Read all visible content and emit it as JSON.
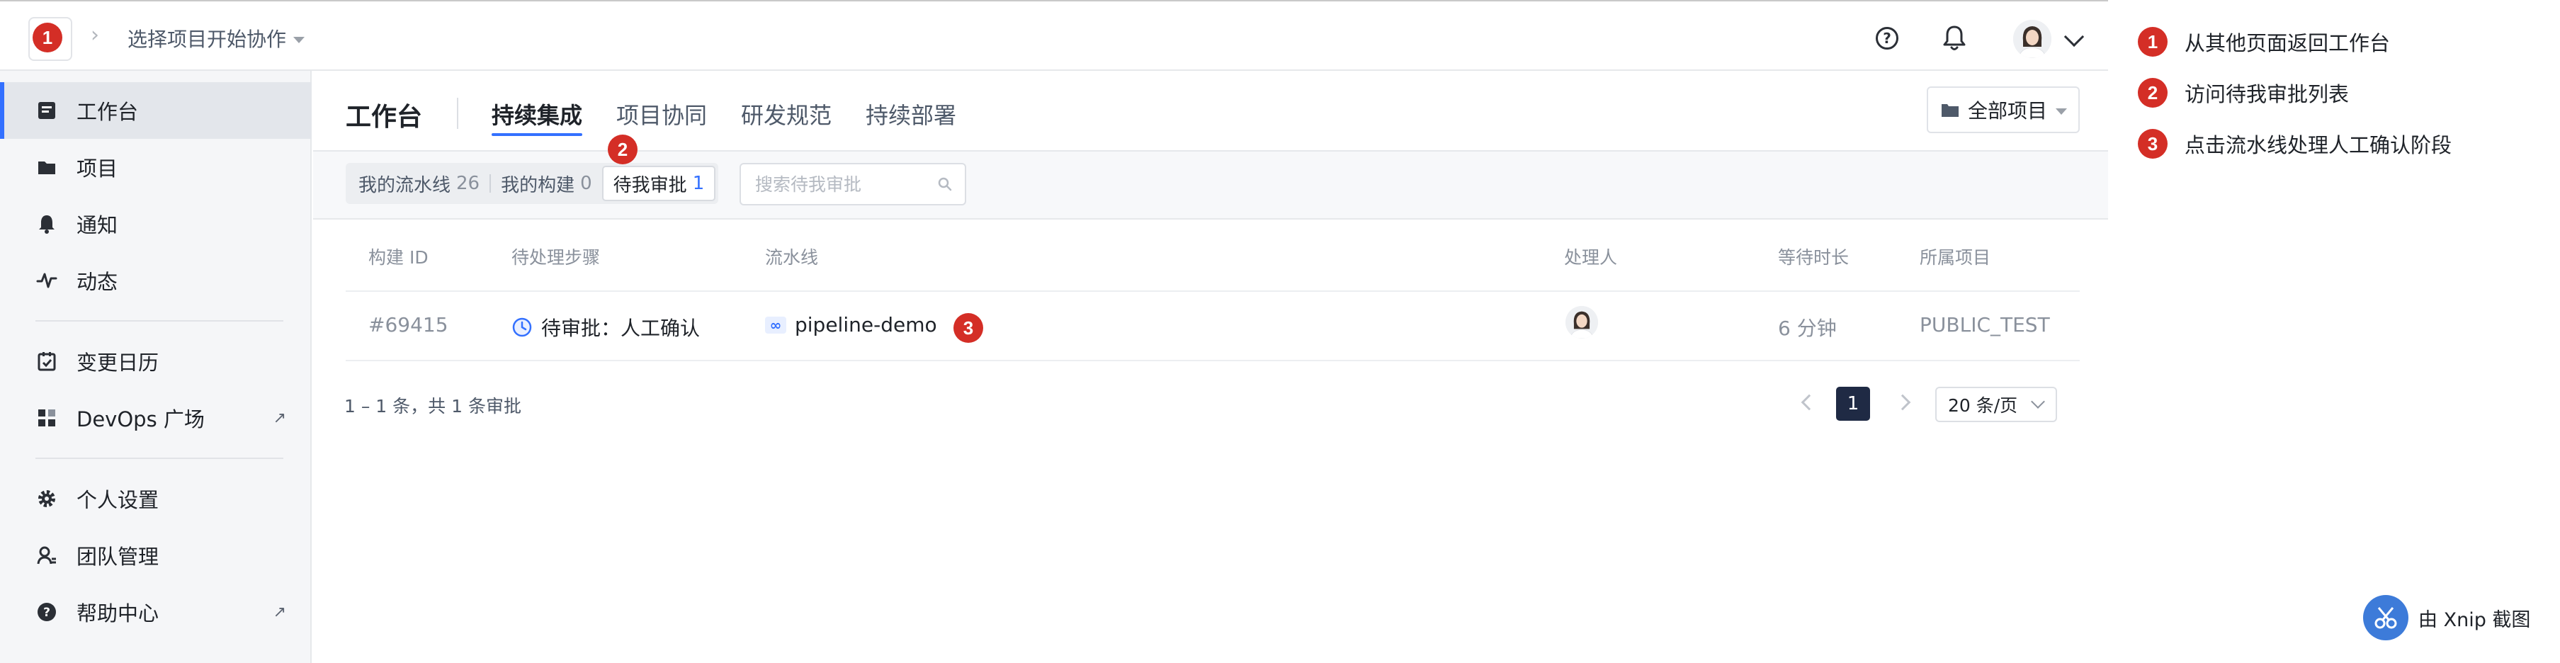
{
  "topbar": {
    "project_select_label": "选择项目开始协作",
    "breadcrumb_sep": "›"
  },
  "sidebar": {
    "items": [
      {
        "label": "工作台",
        "icon": "workbench-icon",
        "active": true
      },
      {
        "label": "项目",
        "icon": "folder-icon"
      },
      {
        "label": "通知",
        "icon": "bell-icon"
      },
      {
        "label": "动态",
        "icon": "activity-icon"
      },
      {
        "label": "变更日历",
        "icon": "calendar-icon"
      },
      {
        "label": "DevOps 广场",
        "icon": "apps-grid-icon",
        "external": true
      },
      {
        "label": "个人设置",
        "icon": "gear-icon"
      },
      {
        "label": "团队管理",
        "icon": "team-icon"
      },
      {
        "label": "帮助中心",
        "icon": "help-circle-icon",
        "external": true
      }
    ],
    "external_glyph": "↗"
  },
  "header": {
    "title": "工作台",
    "tabs": [
      {
        "label": "持续集成",
        "active": true
      },
      {
        "label": "项目协同"
      },
      {
        "label": "研发规范"
      },
      {
        "label": "持续部署"
      }
    ],
    "all_projects_label": "全部项目"
  },
  "filters": {
    "segments": [
      {
        "label": "我的流水线",
        "count": "26"
      },
      {
        "label": "我的构建",
        "count": "0"
      },
      {
        "label": "待我审批",
        "count": "1",
        "active": true
      }
    ],
    "search_placeholder": "搜索待我审批"
  },
  "table": {
    "columns": [
      "构建 ID",
      "待处理步骤",
      "流水线",
      "处理人",
      "等待时长",
      "所属项目"
    ],
    "rows": [
      {
        "build_id": "#69415",
        "step": "待审批：人工确认",
        "pipeline": "pipeline-demo",
        "wait": "6 分钟",
        "project": "PUBLIC_TEST"
      }
    ]
  },
  "pagination": {
    "summary": "1 – 1 条，共 1 条审批",
    "current_page": "1",
    "page_size": "20 条/页"
  },
  "markers": [
    "1",
    "2",
    "3"
  ],
  "annotations": [
    {
      "num": "1",
      "text": "从其他页面返回工作台"
    },
    {
      "num": "2",
      "text": "访问待我审批列表"
    },
    {
      "num": "3",
      "text": "点击流水线处理人工确认阶段"
    }
  ],
  "watermark": "由 Xnip 截图",
  "colors": {
    "accent": "#3370ff",
    "marker_red": "#d42e26",
    "sidebar_bg": "#f5f6f8",
    "page_active_bg": "#1f2a44"
  }
}
